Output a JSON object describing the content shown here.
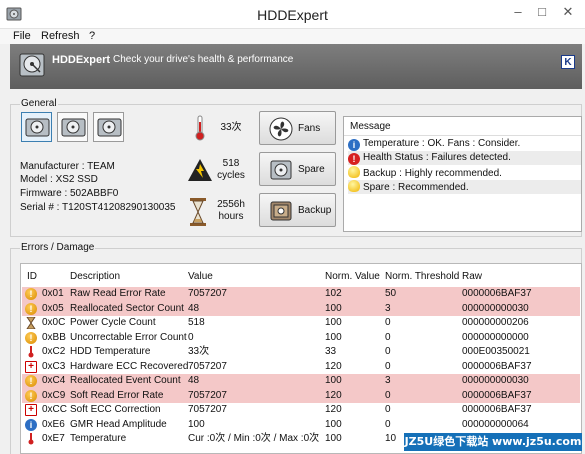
{
  "window": {
    "title": "HDDExpert",
    "controls": {
      "minimize": "–",
      "maximize": "□",
      "close": "✕"
    }
  },
  "menu": {
    "items": [
      "File",
      "Refresh",
      "?"
    ]
  },
  "banner": {
    "app_name": "HDDExpert",
    "tagline": "Check your drive's health & performance",
    "badge": "K"
  },
  "general": {
    "label": "General",
    "drives_count": 3,
    "selected_drive": 1,
    "info": {
      "manufacturer": "Manufacturer : TEAM",
      "model": "Model : XS2 SSD",
      "firmware": "Firmware : 502ABBF0",
      "serial": "Serial # : T120ST4120829013003​5"
    },
    "stats": {
      "temperature": "33次",
      "cycles_value": "518",
      "cycles_unit": "cycles",
      "hours_value": "2556h",
      "hours_unit": "hours"
    },
    "buttons": {
      "fans": "Fans",
      "spare": "Spare",
      "backup": "Backup"
    },
    "messages": {
      "header": "Message",
      "items": [
        {
          "icon": "info-icon",
          "text": "Temperature : OK. Fans : Consider."
        },
        {
          "icon": "error-icon",
          "text": "Health Status : Failures detected."
        },
        {
          "icon": "bulb-icon",
          "text": "Backup : Highly recommended."
        },
        {
          "icon": "bulb-icon",
          "text": "Spare : Recommended."
        }
      ]
    }
  },
  "errors": {
    "label": "Errors / Damage",
    "columns": [
      "ID",
      "Description",
      "Value",
      "Norm. Value",
      "Norm. Threshold",
      "Raw"
    ],
    "rows": [
      {
        "icon": "warning-icon",
        "highlight": true,
        "id": "0x01",
        "desc": "Raw Read Error Rate",
        "value": "7057207",
        "norm": "102",
        "thr": "50",
        "raw": "0000006BAF37"
      },
      {
        "icon": "warning-icon",
        "highlight": true,
        "id": "0x05",
        "desc": "Reallocated Sector Count",
        "value": "48",
        "norm": "100",
        "thr": "3",
        "raw": "000000000030"
      },
      {
        "icon": "hourglass-icon",
        "highlight": false,
        "id": "0x0C",
        "desc": "Power Cycle Count",
        "value": "518",
        "norm": "100",
        "thr": "0",
        "raw": "000000000206"
      },
      {
        "icon": "warning-icon",
        "highlight": false,
        "id": "0xBB",
        "desc": "Uncorrectable Error Count",
        "value": "0",
        "norm": "100",
        "thr": "0",
        "raw": "000000000000"
      },
      {
        "icon": "thermometer-icon",
        "highlight": false,
        "id": "0xC2",
        "desc": "HDD Temperature",
        "value": "33次",
        "norm": "33",
        "thr": "0",
        "raw": "000E00350021"
      },
      {
        "icon": "plus-icon",
        "highlight": false,
        "id": "0xC3",
        "desc": "Hardware ECC Recovered",
        "value": "7057207",
        "norm": "120",
        "thr": "0",
        "raw": "0000006BAF37"
      },
      {
        "icon": "warning-icon",
        "highlight": true,
        "id": "0xC4",
        "desc": "Reallocated Event Count",
        "value": "48",
        "norm": "100",
        "thr": "3",
        "raw": "000000000030"
      },
      {
        "icon": "warning-icon",
        "highlight": true,
        "id": "0xC9",
        "desc": "Soft Read Error Rate",
        "value": "7057207",
        "norm": "120",
        "thr": "0",
        "raw": "0000006BAF37"
      },
      {
        "icon": "plus-icon",
        "highlight": false,
        "id": "0xCC",
        "desc": "Soft ECC Correction",
        "value": "7057207",
        "norm": "120",
        "thr": "0",
        "raw": "0000006BAF37"
      },
      {
        "icon": "info-icon",
        "highlight": false,
        "id": "0xE6",
        "desc": "GMR Head Amplitude",
        "value": "100",
        "norm": "100",
        "thr": "0",
        "raw": "000000000064"
      },
      {
        "icon": "thermometer-icon",
        "highlight": false,
        "id": "0xE7",
        "desc": "Temperature",
        "value": "Cur :0次 / Min :0次 / Max :0次",
        "norm": "100",
        "thr": "10",
        "raw": ""
      }
    ]
  },
  "watermark": "JZ5U绿色下载站 www.jz5u.com"
}
